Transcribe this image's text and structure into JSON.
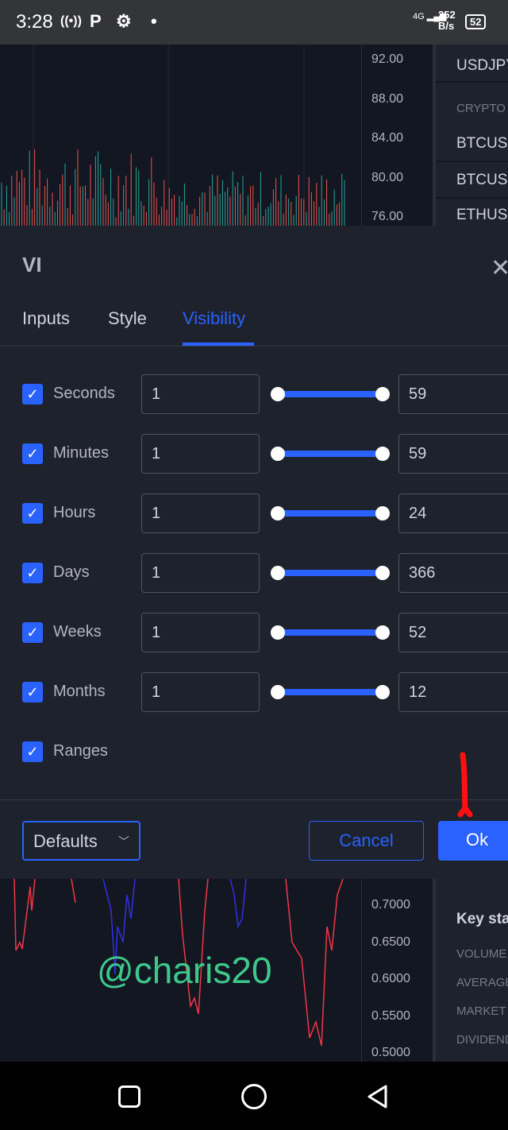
{
  "status_bar": {
    "time": "3:28",
    "network": "4G",
    "speed": "252",
    "speed_unit": "B/s",
    "battery": "52"
  },
  "chart": {
    "top_ticks": [
      "92.00",
      "88.00",
      "84.00",
      "80.00",
      "76.00"
    ],
    "bottom_ticks": [
      "0.7000",
      "0.6500",
      "0.6000",
      "0.5500",
      "0.5000"
    ],
    "up_color": "#26a69a",
    "down_color": "#ef5350",
    "line_colors": [
      "#f23645",
      "#3030e0"
    ]
  },
  "sidebar": {
    "items": [
      "USDJPY",
      "BTCUSD",
      "BTCUSD",
      "ETHUSD"
    ],
    "section": "CRYPTO",
    "key_stats": "Key stats",
    "stats": [
      "VOLUME",
      "AVERAGE",
      "MARKET",
      "DIVIDEND"
    ]
  },
  "dialog": {
    "title": "VI",
    "tabs": [
      {
        "label": "Inputs"
      },
      {
        "label": "Style"
      },
      {
        "label": "Visibility"
      }
    ],
    "active_tab": "Visibility",
    "rows": [
      {
        "label": "Seconds",
        "checked": true,
        "from": "1",
        "to": "59"
      },
      {
        "label": "Minutes",
        "checked": true,
        "from": "1",
        "to": "59"
      },
      {
        "label": "Hours",
        "checked": true,
        "from": "1",
        "to": "24"
      },
      {
        "label": "Days",
        "checked": true,
        "from": "1",
        "to": "366"
      },
      {
        "label": "Weeks",
        "checked": true,
        "from": "1",
        "to": "52"
      },
      {
        "label": "Months",
        "checked": true,
        "from": "1",
        "to": "12"
      }
    ],
    "ranges": {
      "label": "Ranges",
      "checked": true
    },
    "defaults_label": "Defaults",
    "cancel_label": "Cancel",
    "ok_label": "Ok",
    "accent": "#2962ff"
  },
  "watermark": "@charis20"
}
